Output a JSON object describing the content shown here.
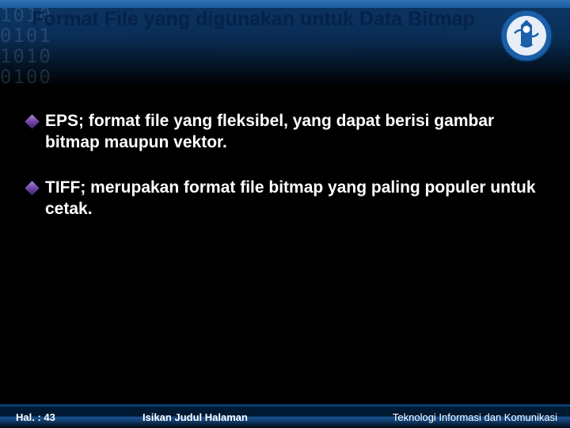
{
  "title": "Format File yang digunakan untuk Data Bitmap",
  "binary_deco": "1010\n0101\n1010\n0100",
  "bullets": [
    "EPS; format file yang fleksibel, yang dapat berisi gambar bitmap maupun vektor.",
    "TIFF; merupakan format file bitmap yang paling populer untuk cetak."
  ],
  "footer": {
    "page": "Hal. : 43",
    "center": "Isikan Judul Halaman",
    "right": "Teknologi Informasi dan Komunikasi"
  },
  "logo": {
    "name": "tut-wuri-handayani-logo"
  }
}
